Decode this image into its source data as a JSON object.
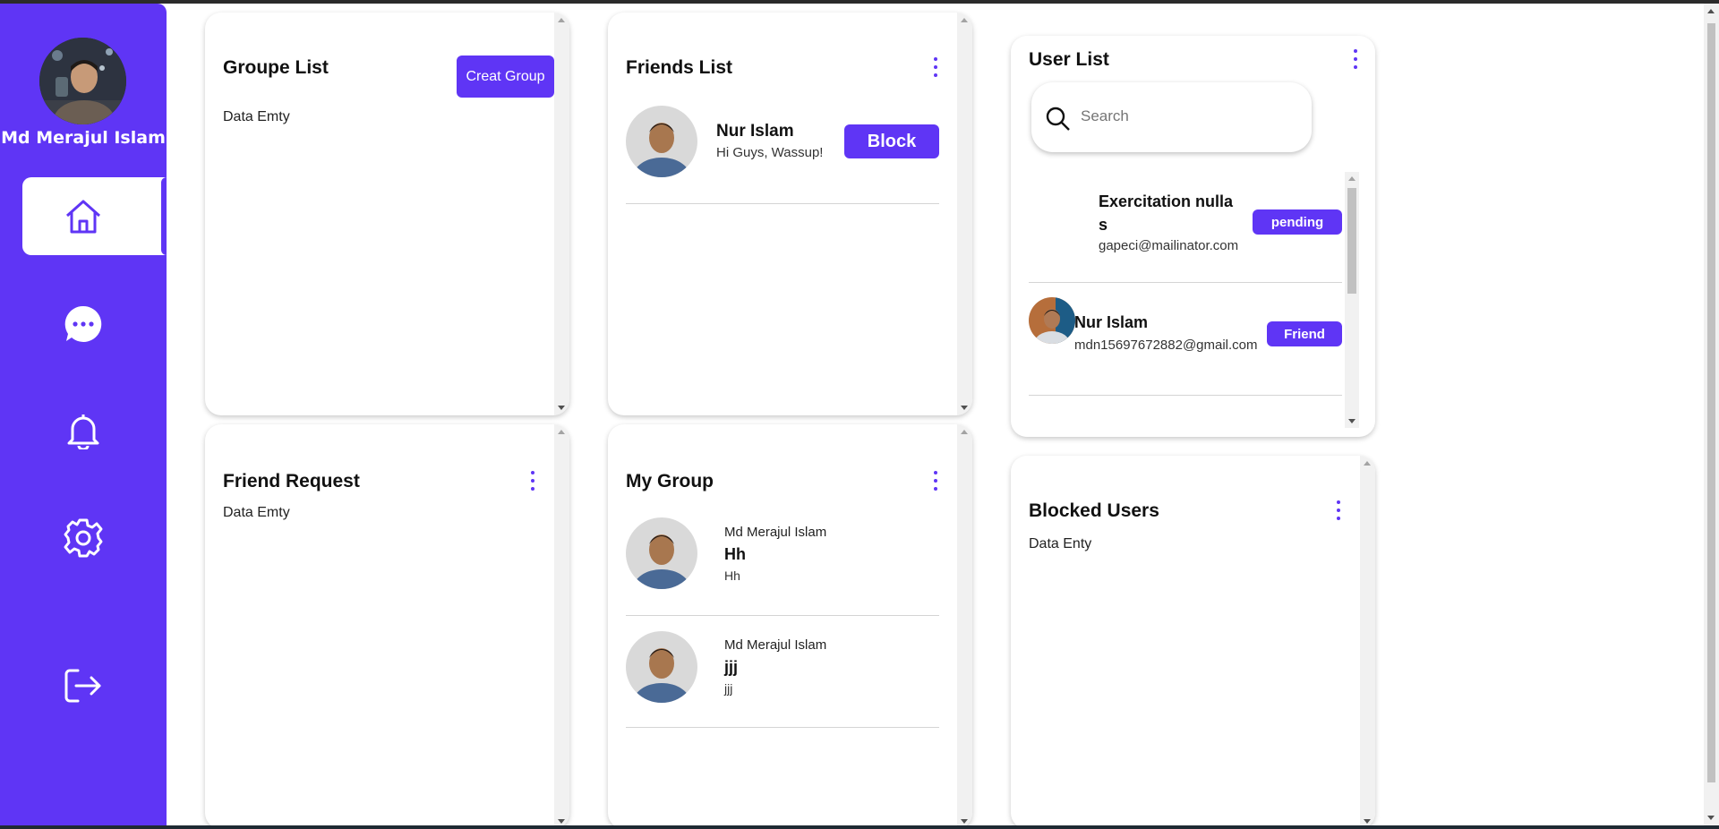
{
  "colors": {
    "accent": "#5f35f5",
    "white": "#ffffff"
  },
  "sidebar": {
    "user_name": "Md Merajul Islam",
    "nav": [
      "home-icon",
      "chat-icon",
      "bell-icon",
      "gear-icon",
      "logout-icon"
    ],
    "active": "home"
  },
  "group_list": {
    "title": "Groupe List",
    "create_button": "Creat Group",
    "empty": "Data Emty"
  },
  "friends_list": {
    "title": "Friends List",
    "items": [
      {
        "name": "Nur Islam",
        "message": "Hi Guys, Wassup!",
        "action": "Block"
      }
    ]
  },
  "user_list": {
    "title": "User List",
    "search_placeholder": "Search",
    "items": [
      {
        "name": "Exercitation nulla s",
        "email": "gapeci@mailinator.com",
        "status": "pending"
      },
      {
        "name": "Nur Islam",
        "email": "mdn15697672882@gmail.com",
        "status": "Friend"
      }
    ]
  },
  "friend_request": {
    "title": "Friend Request",
    "empty": "Data Emty"
  },
  "my_group": {
    "title": "My Group",
    "items": [
      {
        "admin": "Md Merajul Islam",
        "name": "Hh",
        "tagline": "Hh"
      },
      {
        "admin": "Md Merajul Islam",
        "name": "jjj",
        "tagline": "jjj"
      }
    ]
  },
  "blocked_users": {
    "title": "Blocked Users",
    "empty": "Data Enty"
  }
}
